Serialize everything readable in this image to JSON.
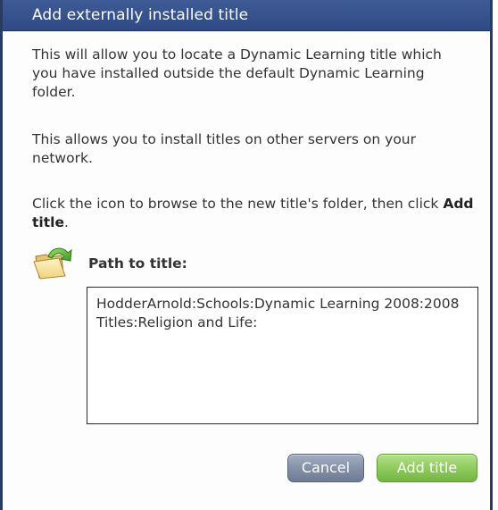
{
  "dialog": {
    "title": "Add externally installed title",
    "paragraph1": "This will allow you to locate a Dynamic Learning title which you have installed outside the default Dynamic Learning folder.",
    "paragraph2": "This allows you to install titles on other servers on your network.",
    "paragraph3_prefix": "Click the icon to browse to the new title's folder, then click ",
    "paragraph3_bold": "Add title",
    "paragraph3_suffix": ".",
    "path_label": "Path to title:",
    "path_value": "HodderArnold:Schools:Dynamic Learning 2008:2008 Titles:Religion and Life:",
    "folder_icon": "folder-browse-icon"
  },
  "buttons": {
    "cancel_label": "Cancel",
    "add_title_label": "Add title"
  },
  "colors": {
    "titlebar": "#3f5b96",
    "cancel_button": "#8591a8",
    "add_button": "#8fcb5d"
  }
}
